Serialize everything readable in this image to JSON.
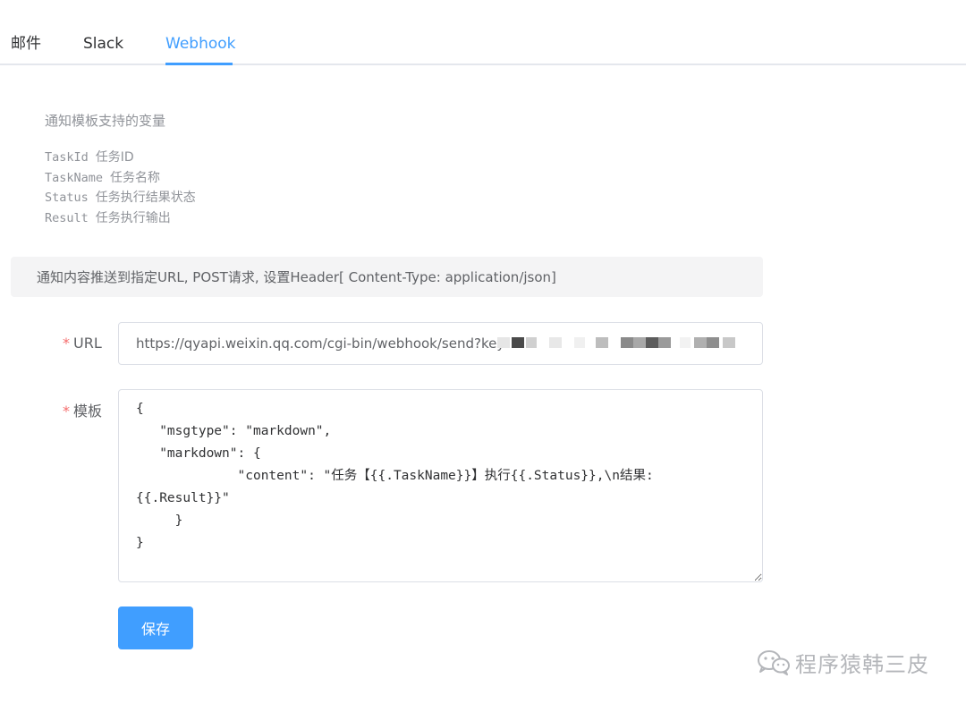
{
  "tabs": [
    {
      "label": "邮件",
      "active": false
    },
    {
      "label": "Slack",
      "active": false
    },
    {
      "label": "Webhook",
      "active": true
    }
  ],
  "help": {
    "title": "通知模板支持的变量",
    "variables": [
      {
        "key": "TaskId",
        "desc": "任务ID"
      },
      {
        "key": "TaskName",
        "desc": "任务名称"
      },
      {
        "key": "Status",
        "desc": "任务执行结果状态"
      },
      {
        "key": "Result",
        "desc": "任务执行输出"
      }
    ]
  },
  "info": {
    "text": "通知内容推送到指定URL, POST请求, 设置Header[ Content-Type: application/json]"
  },
  "form": {
    "required_mark": "*",
    "url_label": "URL",
    "url_value": "https://qyapi.weixin.qq.com/cgi-bin/webhook/send?key",
    "template_label": "模板",
    "template_value": "{\n   \"msgtype\": \"markdown\",\n   \"markdown\": {\n             \"content\": \"任务【{{.TaskName}}】执行{{.Status}},\\n结果:\n{{.Result}}\"\n     }\n}",
    "save_label": "保存"
  },
  "watermark": {
    "text": "程序猿韩三皮",
    "icon": "wechat-icon"
  },
  "colors": {
    "primary": "#409eff",
    "required": "#f56c6c",
    "info_bg": "#f4f4f5",
    "muted_text": "#909399"
  }
}
